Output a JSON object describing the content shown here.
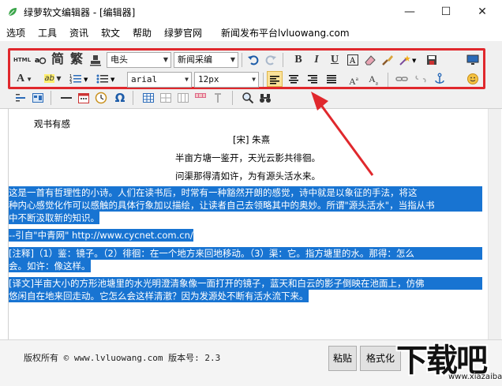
{
  "window": {
    "title": "绿萝软文编辑器 - [编辑器]"
  },
  "menu": [
    "选项",
    "工具",
    "资讯",
    "软文",
    "帮助",
    "绿萝官网",
    "新闻发布平台lvluowang.com"
  ],
  "toolbar": {
    "html_label": "HTML",
    "simplified": "简",
    "traditional": "繁",
    "style_select": "电头",
    "template_select": "新闻采编",
    "bold": "B",
    "italic": "I",
    "underline": "U",
    "font_family": "arial",
    "font_size": "12px",
    "font_color_label": "A",
    "highlight_label": "ab",
    "superscript_label": "A",
    "subscript_label": "A"
  },
  "document": {
    "heading": "观书有感",
    "author": "[宋] 朱熹",
    "poem_line1": "半亩方塘一鉴开，天光云影共徘徊。",
    "poem_line2": "问渠那得清如许，为有源头活水来。",
    "para1_l1": "    这是一首有哲理性的小诗。人们在读书后，时常有一种豁然开朗的感觉，诗中就是以象征的手法，将这",
    "para1_l2": "种内心感觉化作可以感触的具体行象加以描绘，让读者自己去领略其中的奥妙。所谓\"源头活水\"，当指从书",
    "para1_l3": "中不断汲取新的知识。",
    "source_line": "    --引自\"中青网\" http://www.cycnet.com.cn/",
    "note_l1": "    [注释]（1）鉴：镜子。（2）徘徊：在一个地方来回地移动。（3）渠：它。指方塘里的水。那得：怎么",
    "note_l2": "会。如许：像这样。",
    "trans_l1": "    [译文]半亩大小的方形池塘里的水光明澄清象像一面打开的镜子，蓝天和白云的影子倒映在池面上，仿佛",
    "trans_l2": "悠闲自在地来回走动。它怎么会这样清澈？因为发源处不断有活水流下来。"
  },
  "footer": {
    "copyright": "版权所有 © www.lvluowang.com 版本号: 2.3",
    "paste_button": "粘贴",
    "format_button": "格式化"
  },
  "watermark": {
    "text": "下载吧",
    "url": "www.xiazaiba.com"
  },
  "colors": {
    "accent_red": "#e0282d",
    "selection": "#1874d2",
    "app_green": "#3aa54a"
  }
}
